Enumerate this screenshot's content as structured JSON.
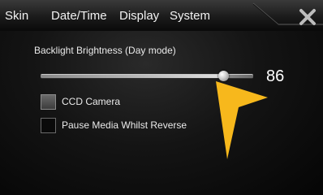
{
  "tabs": {
    "skin": "Skin",
    "datetime": "Date/Time",
    "display": "Display",
    "system": "System"
  },
  "close_icon": "close-x-icon",
  "settings": {
    "brightness_label": "Backlight Brightness (Day mode)",
    "brightness_value": "86",
    "brightness_level": 0.86,
    "ccd_camera_label": "CCD Camera",
    "ccd_camera_checked": true,
    "pause_media_label": "Pause Media Whilst Reverse",
    "pause_media_checked": false
  },
  "colors": {
    "pointer_arrow": "#f7b81c",
    "text": "#eaeaea"
  }
}
